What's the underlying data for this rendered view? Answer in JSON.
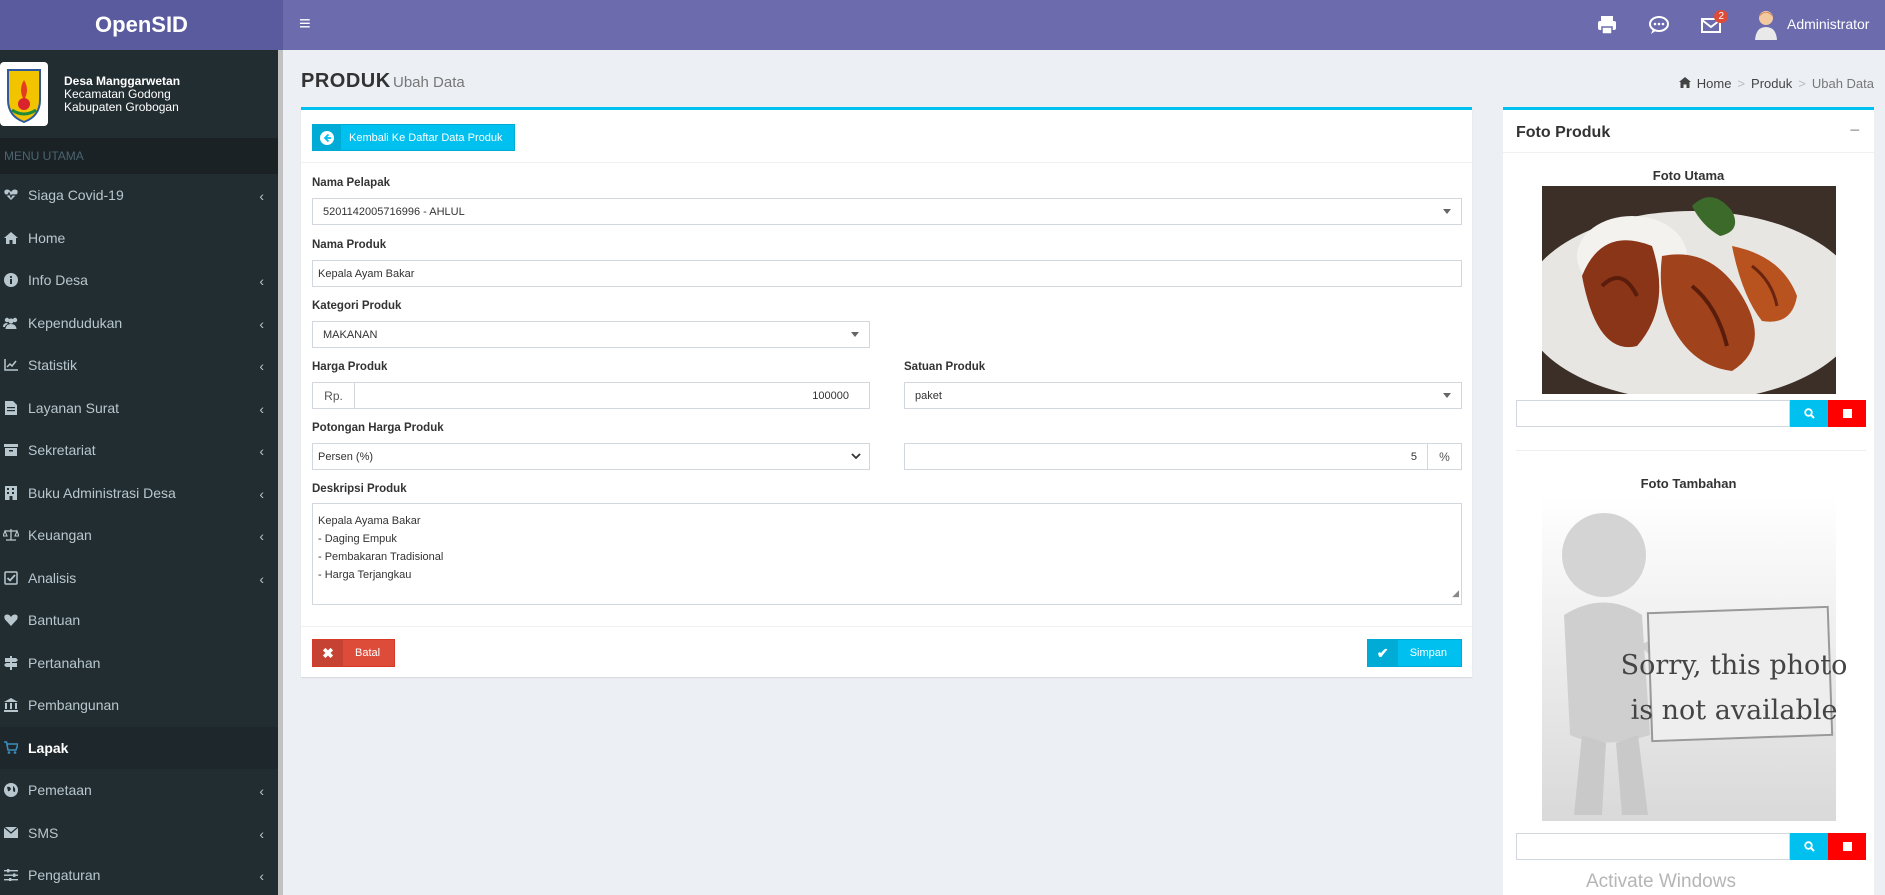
{
  "app": {
    "title": "OpenSID"
  },
  "topbar": {
    "notification_count": "2",
    "user_name": "Administrator"
  },
  "village": {
    "name": "Desa Manggarwetan",
    "district": "Kecamatan Godong",
    "regency": "Kabupaten Grobogan"
  },
  "sidebar": {
    "header": "MENU UTAMA",
    "items": [
      {
        "label": "Siaga Covid-19"
      },
      {
        "label": "Home"
      },
      {
        "label": "Info Desa"
      },
      {
        "label": "Kependudukan"
      },
      {
        "label": "Statistik"
      },
      {
        "label": "Layanan Surat"
      },
      {
        "label": "Sekretariat"
      },
      {
        "label": "Buku Administrasi Desa"
      },
      {
        "label": "Keuangan"
      },
      {
        "label": "Analisis"
      },
      {
        "label": "Bantuan"
      },
      {
        "label": "Pertanahan"
      },
      {
        "label": "Pembangunan"
      },
      {
        "label": "Lapak"
      },
      {
        "label": "Pemetaan"
      },
      {
        "label": "SMS"
      },
      {
        "label": "Pengaturan"
      }
    ]
  },
  "page": {
    "title": "PRODUK",
    "subtitle": "Ubah Data"
  },
  "breadcrumb": {
    "home": "Home",
    "produk": "Produk",
    "current": "Ubah Data"
  },
  "form": {
    "back_button": "Kembali Ke Daftar Data Produk",
    "seller_label": "Nama Pelapak",
    "seller_value": "5201142005716996 - AHLUL",
    "product_name_label": "Nama Produk",
    "product_name_value": "Kepala Ayam Bakar",
    "category_label": "Kategori Produk",
    "category_value": "MAKANAN",
    "price_label": "Harga Produk",
    "price_prefix": "Rp.",
    "price_value": "100000",
    "unit_label": "Satuan Produk",
    "unit_value": "paket",
    "discount_label": "Potongan Harga Produk",
    "discount_type": "Persen (%)",
    "discount_value": "5",
    "discount_suffix": "%",
    "description_label": "Deskripsi Produk",
    "description_lines": [
      "Kepala Ayama Bakar",
      "- Daging Empuk",
      "- Pembakaran Tradisional",
      "- Harga Terjangkau"
    ],
    "cancel_button": "Batal",
    "save_button": "Simpan"
  },
  "photos": {
    "title": "Foto Produk",
    "main_label": "Foto Utama",
    "extra_label": "Foto Tambahan",
    "placeholder_line1": "Sorry, this photo",
    "placeholder_line2": "is not available"
  },
  "watermark": "Activate Windows"
}
